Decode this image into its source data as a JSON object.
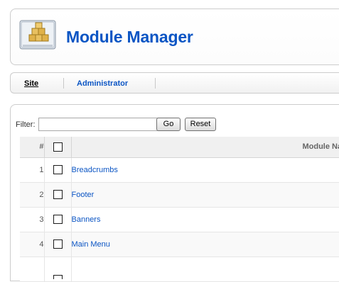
{
  "header": {
    "title": "Module Manager",
    "icon": "module-manager-icon"
  },
  "tabs": [
    {
      "label": "Site",
      "active": true
    },
    {
      "label": "Administrator",
      "active": false
    }
  ],
  "filter": {
    "label": "Filter:",
    "value": "",
    "go_label": "Go",
    "reset_label": "Reset"
  },
  "table": {
    "columns": {
      "number": "#",
      "name": "Module Name"
    },
    "rows": [
      {
        "number": "1",
        "name": "Breadcrumbs"
      },
      {
        "number": "2",
        "name": "Footer"
      },
      {
        "number": "3",
        "name": "Banners"
      },
      {
        "number": "4",
        "name": "Main Menu"
      }
    ]
  },
  "colors": {
    "link_blue": "#0b55c4",
    "border": "#cccccc",
    "header_bg": "#f0f0f0"
  }
}
